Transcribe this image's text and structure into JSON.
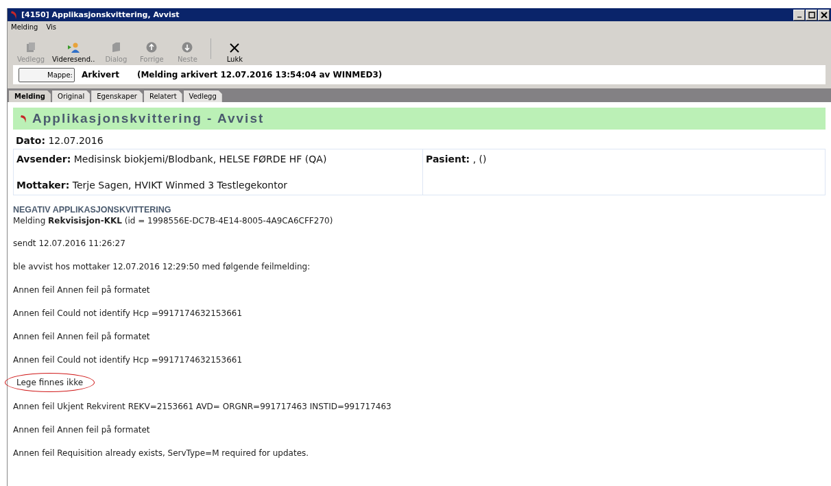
{
  "window": {
    "title": "[4150] Applikasjonskvittering, Avvist"
  },
  "menu": [
    "Melding",
    "Vis"
  ],
  "toolbar": [
    {
      "label": "Vedlegg",
      "kind": "attach",
      "disabled": true
    },
    {
      "label": "Videresend..",
      "kind": "forward",
      "disabled": false
    },
    {
      "label": "Dialog",
      "kind": "dialog",
      "disabled": true
    },
    {
      "label": "Forrige",
      "kind": "up",
      "disabled": true
    },
    {
      "label": "Neste",
      "kind": "down",
      "disabled": true
    },
    {
      "label": "Lukk",
      "kind": "close",
      "disabled": false
    }
  ],
  "folder": {
    "button": "Mappe:",
    "value": "Arkivert",
    "info": "(Melding arkivert 12.07.2016 13:54:04 av WINMED3)"
  },
  "tabs": [
    {
      "label": "Melding",
      "selected": true
    },
    {
      "label": "Original",
      "selected": false
    },
    {
      "label": "Egenskaper",
      "selected": false
    },
    {
      "label": "Relatert",
      "selected": false
    },
    {
      "label": "Vedlegg",
      "selected": false
    }
  ],
  "heading": "Applikasjonskvittering - Avvist",
  "date": {
    "label": "Dato:",
    "value": "12.07.2016"
  },
  "sender": {
    "label": "Avsender:",
    "value": "Medisinsk biokjemi/Blodbank, HELSE FØRDE HF (QA)"
  },
  "receiver": {
    "label": "Mottaker:",
    "value": "Terje Sagen, HVIKT Winmed 3 Testlegekontor"
  },
  "patient": {
    "label": "Pasient:",
    "value": ", ()"
  },
  "section_title": "NEGATIV APPLIKASJONSKVITTERING",
  "lines": [
    {
      "text": "Melding **Rekvisisjon-KKL** (id = 1998556E-DC7B-4E14-8005-4A9CA6CFF270)",
      "circled": false
    },
    {
      "text": "sendt 12.07.2016 11:26:27",
      "circled": false
    },
    {
      "text": "ble avvist hos mottaker 12.07.2016 12:29:50 med følgende feilmelding:",
      "circled": false
    },
    {
      "text": "Annen feil Annen feil på formatet",
      "circled": false
    },
    {
      "text": "Annen feil Could not identify Hcp =9917174632153661",
      "circled": false
    },
    {
      "text": "Annen feil Annen feil på formatet",
      "circled": false
    },
    {
      "text": "Annen feil Could not identify Hcp =9917174632153661",
      "circled": false
    },
    {
      "text": "Lege finnes ikke",
      "circled": true
    },
    {
      "text": "Annen feil Ukjent Rekvirent REKV=2153661 AVD= ORGNR=991717463 INSTID=991717463",
      "circled": false
    },
    {
      "text": "Annen feil Annen feil på formatet",
      "circled": false
    },
    {
      "text": "Annen feil Requisition already exists, ServType=M required for updates.",
      "circled": false
    }
  ]
}
